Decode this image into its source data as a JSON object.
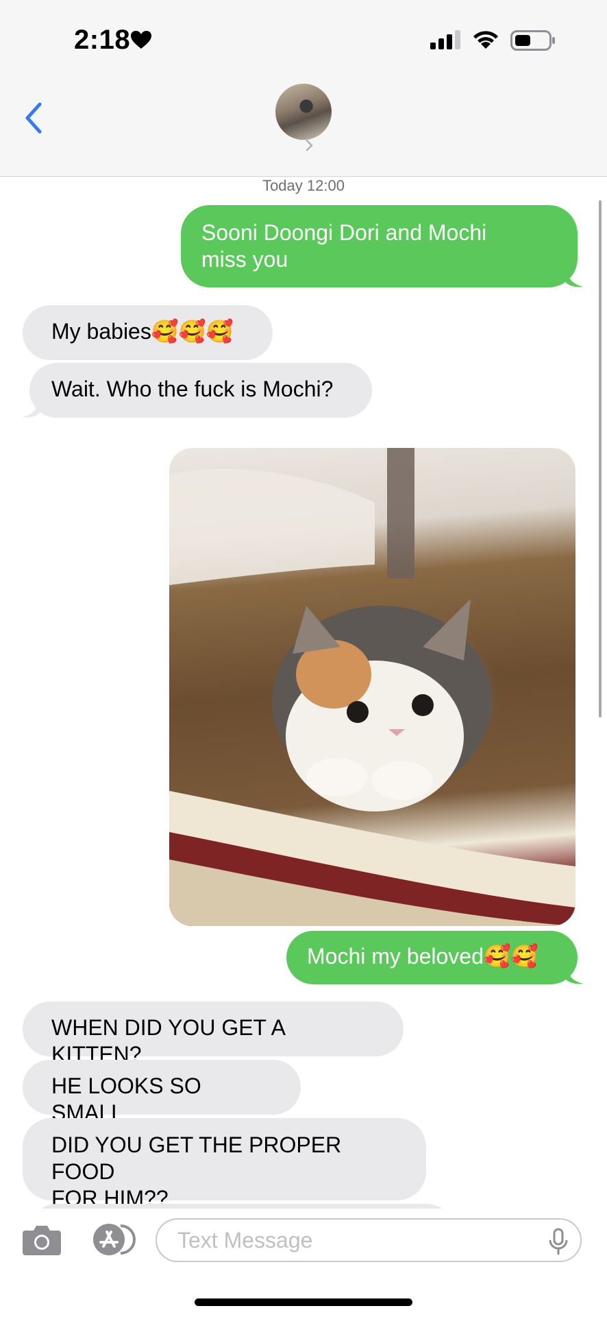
{
  "status_bar": {
    "time": "2:18",
    "icons": [
      "heart-icon",
      "signal-icon",
      "wifi-icon",
      "battery-icon"
    ]
  },
  "header": {
    "back_icon": "chevron-left-icon",
    "avatar_icon": "contact-photo",
    "detail_icon": "chevron-right-icon"
  },
  "thread": {
    "timestamp": "Today 12:00",
    "messages": [
      {
        "from": "me",
        "lines": [
          "Sooni Doongi Dori and Mochi",
          "miss you"
        ]
      },
      {
        "from": "them",
        "text": "My babies🥰🥰🥰"
      },
      {
        "from": "them",
        "text": "Wait. Who the fuck is Mochi?"
      },
      {
        "from": "me",
        "type": "photo",
        "alt": "kitten-photo"
      },
      {
        "from": "me",
        "text": "Mochi my beloved🥰🥰"
      },
      {
        "from": "them",
        "text": "WHEN DID YOU GET A KITTEN?"
      },
      {
        "from": "them",
        "text": "HE LOOKS SO SMALL"
      },
      {
        "from": "them",
        "lines": [
          "DID YOU GET THE PROPER FOOD",
          "FOR HIM??"
        ]
      }
    ]
  },
  "compose": {
    "placeholder": "Text Message",
    "camera_icon": "camera-icon",
    "apps_icon": "app-store-icon",
    "mic_icon": "microphone-icon"
  },
  "colors": {
    "sent_bubble": "#5ac85a",
    "received_bubble": "#e9e9eb",
    "accent": "#3478f6"
  }
}
